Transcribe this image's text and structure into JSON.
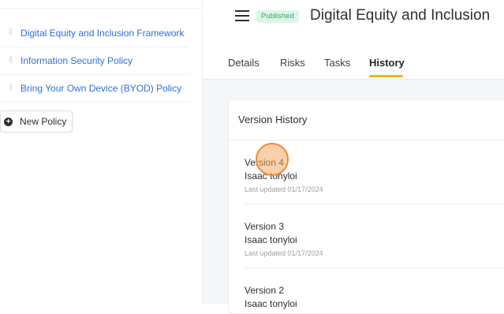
{
  "sidebar": {
    "items": [
      {
        "label": "Digital Equity and Inclusion Framework"
      },
      {
        "label": "Information Security Policy"
      },
      {
        "label": "Bring Your Own Device (BYOD) Policy"
      }
    ],
    "new_policy_label": "New Policy"
  },
  "header": {
    "status": "Published",
    "title": "Digital Equity and Inclusion"
  },
  "tabs": [
    {
      "label": "Details"
    },
    {
      "label": "Risks"
    },
    {
      "label": "Tasks"
    },
    {
      "label": "History"
    }
  ],
  "history": {
    "title": "Version History",
    "versions": [
      {
        "label": "Version 4",
        "author": "Isaac tonyloi",
        "updated": "Last updated 01/17/2024"
      },
      {
        "label": "Version 3",
        "author": "Isaac tonyloi",
        "updated": "Last updated 01/17/2024"
      },
      {
        "label": "Version 2",
        "author": "Isaac tonyloi",
        "updated": ""
      }
    ]
  },
  "colors": {
    "link": "#2f6fd6",
    "badge_bg": "#dff5e9",
    "badge_text": "#2ea86a",
    "active_tab_underline": "#f2b705",
    "click_marker": "#ee8a3c"
  }
}
